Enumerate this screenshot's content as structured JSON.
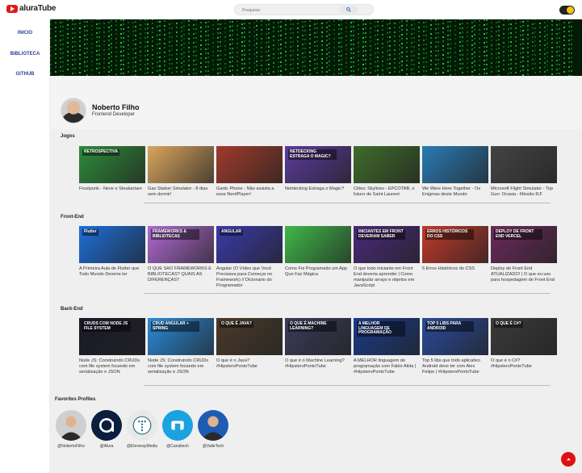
{
  "header": {
    "logo_text": "aluraTube",
    "search_placeholder": "Pesquisar",
    "theme_toggle": "dark"
  },
  "sidebar": {
    "items": [
      {
        "label": "INICIO"
      },
      {
        "label": "BIBLIOTECA"
      },
      {
        "label": "GITHUB"
      }
    ]
  },
  "channel": {
    "name": "Noberto Filho",
    "role": "Frontend Developer"
  },
  "sections": [
    {
      "title": "Jogos",
      "videos": [
        {
          "title": "Frostpunk - Neve e Steakartare",
          "thumb_text": "RETROSPECTIVA",
          "color": "#2e8b3a"
        },
        {
          "title": "Gas Station Simulator - 8 dias sem dormir!",
          "thumb_text": "",
          "color": "#d9a55e"
        },
        {
          "title": "Gartic Phone - Não assista a esse NerdPlayer!",
          "thumb_text": "",
          "color": "#a03a2a"
        },
        {
          "title": "Netdecking Estraga o Magic?",
          "thumb_text": "NETDECKING ESTRAGA O MAGIC?",
          "color": "#5a3a9a"
        },
        {
          "title": "Cities: Skylines - EPCOTAB, o futuro de Saint Laurent",
          "thumb_text": "",
          "color": "#3f6b2a"
        },
        {
          "title": "We Were Here Together - Os Enigmas deste Mundo",
          "thumb_text": "",
          "color": "#2a7bb5"
        },
        {
          "title": "Microsoft Flight Simulator - Top Gun: Ocasia - Missão RJ!",
          "thumb_text": "",
          "color": "#444444"
        }
      ]
    },
    {
      "title": "Front-End",
      "videos": [
        {
          "title": "A Primeira Aula de Flutter que Todo Mundo Deveria ter",
          "thumb_text": "Flutter",
          "color": "#1e6fd9"
        },
        {
          "title": "O QUE SÃO FRAMEWORKS E BIBLIOTECAS? QUAIS AS DIFERENÇAS?",
          "thumb_text": "FRAMEWORKS & BIBLIOTECAS",
          "color": "#b06ad1"
        },
        {
          "title": "Angular (O Vídeo que Você Precisava para Começar no Framework) // Dicionário do Programador",
          "thumb_text": "ANGULAR",
          "color": "#3a3aa8"
        },
        {
          "title": "Como Foi Programado um App Que Faz Mágica",
          "thumb_text": "",
          "color": "#3fb84a"
        },
        {
          "title": "O que todo iniciante em Front End deveria aprender | Como manipular arrays e objetos em JavaScript",
          "thumb_text": "INICIANTES EM FRONT DEVERIAM SABER",
          "color": "#4a2a7a"
        },
        {
          "title": "5 Erros Históricos do CSS",
          "thumb_text": "ERROS HISTÓRICOS DO CSS",
          "color": "#c0392b"
        },
        {
          "title": "Deploy de Front End ATUALIZADO! | O que eu uso para hospedagem de Front End",
          "thumb_text": "DEPLOY DE FRONT END VERCEL",
          "color": "#6a2a5a"
        }
      ]
    },
    {
      "title": "Back-End",
      "videos": [
        {
          "title": "Node JS: Construindo CRUDs com file system focando em serialização e JSON",
          "thumb_text": "CRUDS COM NODE JS FILE SYSTEM",
          "color": "#1a1a2a"
        },
        {
          "title": "Node JS: Construindo CRUDs com file system focando em serialização e JSON",
          "thumb_text": "CRUD ANGULAR + SPRING",
          "color": "#2a8bd9"
        },
        {
          "title": "O que é o Java? #HipstersPontoTube",
          "thumb_text": "O QUE É JAVA?",
          "color": "#4a3a2a"
        },
        {
          "title": "O que é o Machine Learning? #HipstersPontoTube",
          "thumb_text": "O QUE É MACHINE LEARNING?",
          "color": "#3a3a5a"
        },
        {
          "title": "A MELHOR linguagem de programação com Fabio Akita | #HipstersPontoTube",
          "thumb_text": "A MELHOR LINGUAGEM DE PROGRAMAÇÃO",
          "color": "#1a3a8a"
        },
        {
          "title": "Top 5 libs que todo aplicativo Android deve ter com Alex Felipe | #HipstersPontoTube",
          "thumb_text": "TOP 5 LIBS PARA ANDROID",
          "color": "#2a4a9a"
        },
        {
          "title": "O que é o C#? #HipstersPontoTube",
          "thumb_text": "O QUE É C#?",
          "color": "#3a3a3a"
        }
      ]
    }
  ],
  "favorites": {
    "title": "Favorites Profiles",
    "profiles": [
      {
        "handle": "@NobertoFilho",
        "color": "#cfcfcf",
        "icon": "person-avatar"
      },
      {
        "handle": "@Alura",
        "color": "#0a1f3d",
        "icon": "alura-logo"
      },
      {
        "handle": "@EleverayMedia",
        "color": "#e8e8e8",
        "icon": "dots-logo"
      },
      {
        "handle": "@Canaltech",
        "color": "#1aa3e0",
        "icon": "canaltech-logo"
      },
      {
        "handle": "@ValleTech",
        "color": "#1e5bb5",
        "icon": "person-avatar"
      }
    ]
  },
  "colors": {
    "accent": "#e01010",
    "sidebar_link": "#2a3f9c",
    "banner_bg": "#031a05"
  }
}
